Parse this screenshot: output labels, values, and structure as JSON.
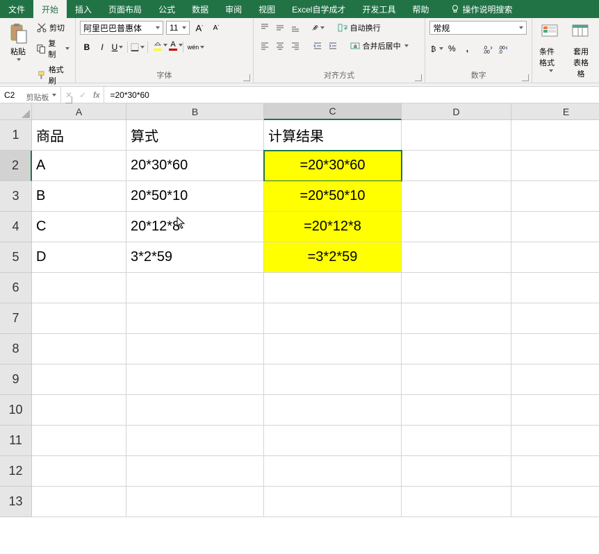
{
  "tabs": [
    "文件",
    "开始",
    "插入",
    "页面布局",
    "公式",
    "数据",
    "审阅",
    "视图",
    "Excel自学成才",
    "开发工具",
    "帮助"
  ],
  "active_tab": 1,
  "tell_me": "操作说明搜索",
  "clipboard": {
    "paste": "粘贴",
    "cut": "剪切",
    "copy": "复制",
    "format_painter": "格式刷",
    "label": "剪贴板"
  },
  "font": {
    "name": "阿里巴巴普惠体",
    "size": "11",
    "label": "字体",
    "wen": "wén"
  },
  "align": {
    "label": "对齐方式",
    "wrap": "自动换行",
    "merge": "合并后居中"
  },
  "number": {
    "label": "数字",
    "format": "常规"
  },
  "styles": {
    "cond": "条件格式",
    "cell": "套用\n表格格"
  },
  "namebox": "C2",
  "formula": "=20*30*60",
  "columns": [
    "A",
    "B",
    "C",
    "D",
    "E"
  ],
  "rows": [
    "1",
    "2",
    "3",
    "4",
    "5",
    "6",
    "7",
    "8",
    "9",
    "10",
    "11",
    "12",
    "13"
  ],
  "active": {
    "col": "C",
    "row": "2"
  },
  "data": {
    "1": {
      "A": "商品",
      "B": "算式",
      "C": "计算结果"
    },
    "2": {
      "A": "A",
      "B": "20*30*60",
      "C": "=20*30*60"
    },
    "3": {
      "A": "B",
      "B": "20*50*10",
      "C": "=20*50*10"
    },
    "4": {
      "A": "C",
      "B": "20*12*8",
      "C": "=20*12*8"
    },
    "5": {
      "A": "D",
      "B": "3*2*59",
      "C": "=3*2*59"
    }
  },
  "highlight": {
    "col": "C",
    "rows": [
      "2",
      "3",
      "4",
      "5"
    ]
  }
}
